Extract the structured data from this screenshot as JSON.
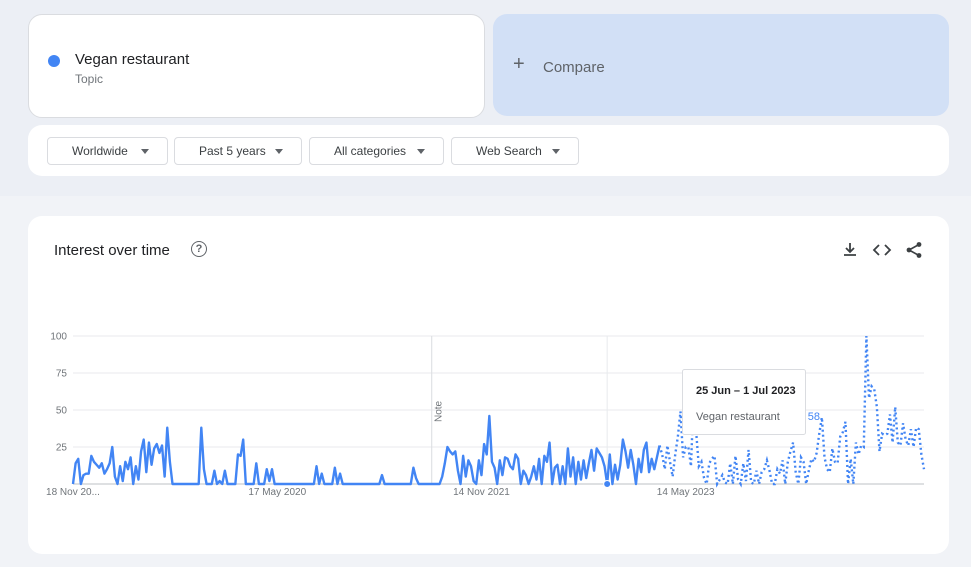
{
  "term": {
    "name": "Vegan restaurant",
    "type": "Topic",
    "color": "#4285f4"
  },
  "compare": {
    "plus": "+",
    "label": "Compare"
  },
  "filters": [
    "Worldwide",
    "Past 5 years",
    "All categories",
    "Web Search"
  ],
  "chart_title": "Interest over time",
  "help_glyph": "?",
  "icons": [
    "download-icon",
    "embed-code-icon",
    "share-icon"
  ],
  "tooltip": {
    "date": "25 Jun – 1 Jul 2023",
    "series": "Vegan restaurant",
    "value": "58"
  },
  "chart_data": {
    "type": "line",
    "title": "",
    "xlabel": "",
    "ylabel": "",
    "ylim": [
      0,
      100
    ],
    "yticks": [
      25,
      50,
      75,
      100
    ],
    "xticks": [
      "18 Nov 20...",
      "17 May 2020",
      "14 Nov 2021",
      "14 May 2023"
    ],
    "note_label": "Note",
    "note_at_index": 137,
    "partial_from_index": 224,
    "highlight_index": 204,
    "series": [
      {
        "color": "#4285f4",
        "values": [
          0,
          14,
          17,
          0,
          6,
          7,
          7,
          19,
          15,
          13,
          11,
          14,
          7,
          10,
          14,
          25,
          5,
          0,
          12,
          2,
          15,
          10,
          18,
          0,
          12,
          3,
          22,
          30,
          8,
          28,
          13,
          24,
          27,
          21,
          26,
          5,
          38,
          15,
          0,
          0,
          0,
          0,
          0,
          0,
          0,
          0,
          0,
          0,
          0,
          38,
          10,
          0,
          0,
          0,
          9,
          0,
          2,
          0,
          9,
          0,
          0,
          0,
          0,
          20,
          19,
          30,
          0,
          0,
          0,
          0,
          14,
          0,
          0,
          0,
          10,
          2,
          10,
          0,
          0,
          0,
          0,
          0,
          0,
          0,
          0,
          0,
          0,
          0,
          0,
          0,
          0,
          0,
          0,
          12,
          0,
          7,
          0,
          0,
          0,
          0,
          11,
          0,
          7,
          0,
          0,
          0,
          0,
          0,
          0,
          0,
          0,
          0,
          0,
          0,
          0,
          0,
          0,
          0,
          6,
          0,
          0,
          0,
          0,
          0,
          0,
          0,
          0,
          0,
          0,
          0,
          11,
          4,
          0,
          0,
          0,
          0,
          0,
          0,
          0,
          0,
          0,
          5,
          14,
          25,
          22,
          20,
          22,
          9,
          0,
          19,
          5,
          16,
          12,
          2,
          0,
          16,
          6,
          27,
          20,
          46,
          15,
          11,
          0,
          16,
          6,
          18,
          17,
          12,
          10,
          20,
          17,
          0,
          9,
          6,
          0,
          5,
          12,
          3,
          17,
          0,
          19,
          15,
          28,
          0,
          11,
          13,
          0,
          12,
          0,
          24,
          5,
          18,
          0,
          15,
          3,
          16,
          4,
          14,
          23,
          9,
          24,
          21,
          18,
          12,
          0,
          20,
          0,
          13,
          3,
          13,
          30,
          22,
          11,
          23,
          13,
          0,
          17,
          8,
          23,
          28,
          8,
          17,
          10,
          18,
          26,
          20,
          10,
          26,
          15,
          5,
          20,
          32,
          49,
          18,
          25,
          25,
          12,
          58,
          35,
          12,
          15,
          4,
          0,
          14,
          17,
          19,
          0,
          3,
          6,
          1,
          0,
          14,
          0,
          19,
          3,
          0,
          14,
          2,
          23,
          1,
          0,
          9,
          0,
          8,
          10,
          16,
          9,
          0,
          0,
          10,
          7,
          16,
          0,
          15,
          22,
          28,
          8,
          0,
          18,
          15,
          0,
          9,
          17,
          15,
          21,
          34,
          45,
          18,
          10,
          8,
          24,
          15,
          14,
          32,
          35,
          42,
          0,
          17,
          0,
          28,
          20,
          26,
          25,
          100,
          58,
          66,
          64,
          52,
          22,
          34,
          33,
          34,
          47,
          28,
          52,
          28,
          26,
          41,
          30,
          26,
          37,
          25,
          38,
          37,
          20,
          10
        ]
      }
    ]
  }
}
